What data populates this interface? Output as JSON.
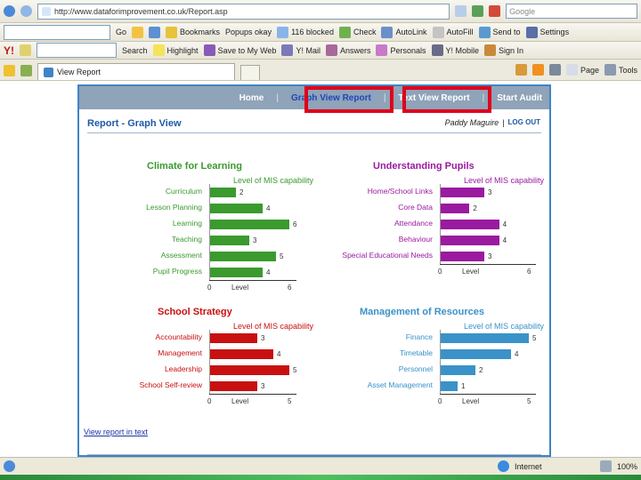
{
  "browser": {
    "url": "http://www.dataforimprovement.co.uk/Report.asp",
    "search_placeholder": "Google",
    "tb2": {
      "go": "Go",
      "bookmarks": "Bookmarks",
      "popups": "Popups okay",
      "blocked": "116 blocked",
      "check": "Check",
      "autolink": "AutoLink",
      "autofill": "AutoFill",
      "sendto": "Send to",
      "settings": "Settings"
    },
    "tb3": {
      "search": "Search",
      "highlight": "Highlight",
      "save": "Save to My Web",
      "mail": "Y! Mail",
      "answers": "Answers",
      "personals": "Personals",
      "mobile": "Y! Mobile",
      "signin": "Sign In"
    },
    "tab_label": "View Report",
    "page_menu": "Page",
    "tools_menu": "Tools",
    "status_zone": "Internet",
    "zoom": "100%"
  },
  "nav": {
    "home": "Home",
    "graph": "Graph View Report",
    "text": "Text View Report",
    "start": "Start Audit",
    "divider": "|"
  },
  "page": {
    "title": "Report - Graph View",
    "user": "Paddy Maguire",
    "logout": "LOG OUT",
    "text_link": "View report in text"
  },
  "chart_data": [
    {
      "type": "bar",
      "title": "Climate for Learning",
      "subtitle": "Level of MIS capability",
      "color": "#3a9a2e",
      "categories": [
        "Curriculum",
        "Lesson Planning",
        "Learning",
        "Teaching",
        "Assessment",
        "Pupil Progress"
      ],
      "values": [
        2,
        4,
        6,
        3,
        5,
        4
      ],
      "xlim": [
        0,
        6
      ],
      "xlabel": "Level",
      "ticks": [
        "0",
        "6"
      ]
    },
    {
      "type": "bar",
      "title": "Understanding Pupils",
      "subtitle": "Level of MIS capability",
      "color": "#9a1aa0",
      "categories": [
        "Home/School Links",
        "Core Data",
        "Attendance",
        "Behaviour",
        "Special Educational Needs"
      ],
      "values": [
        3,
        2,
        4,
        4,
        3
      ],
      "xlim": [
        0,
        6
      ],
      "xlabel": "Level",
      "ticks": [
        "0",
        "6"
      ]
    },
    {
      "type": "bar",
      "title": "School Strategy",
      "subtitle": "Level of MIS capability",
      "color": "#c81010",
      "categories": [
        "Accountability",
        "Management",
        "Leadership",
        "School Self-review"
      ],
      "values": [
        3,
        4,
        5,
        3
      ],
      "xlim": [
        0,
        5
      ],
      "xlabel": "Level",
      "ticks": [
        "0",
        "5"
      ]
    },
    {
      "type": "bar",
      "title": "Management of Resources",
      "subtitle": "Level of MIS capability",
      "color": "#3a92c8",
      "categories": [
        "Finance",
        "Timetable",
        "Personnel",
        "Asset Management"
      ],
      "values": [
        5,
        4,
        2,
        1
      ],
      "xlim": [
        0,
        5
      ],
      "xlabel": "Level",
      "ticks": [
        "0",
        "5"
      ]
    }
  ],
  "colors": {
    "nav_bg": "#8fa3b9",
    "frame": "#3f84c4",
    "highlight": "#e0001a",
    "title_blue": "#1f5aa6"
  }
}
